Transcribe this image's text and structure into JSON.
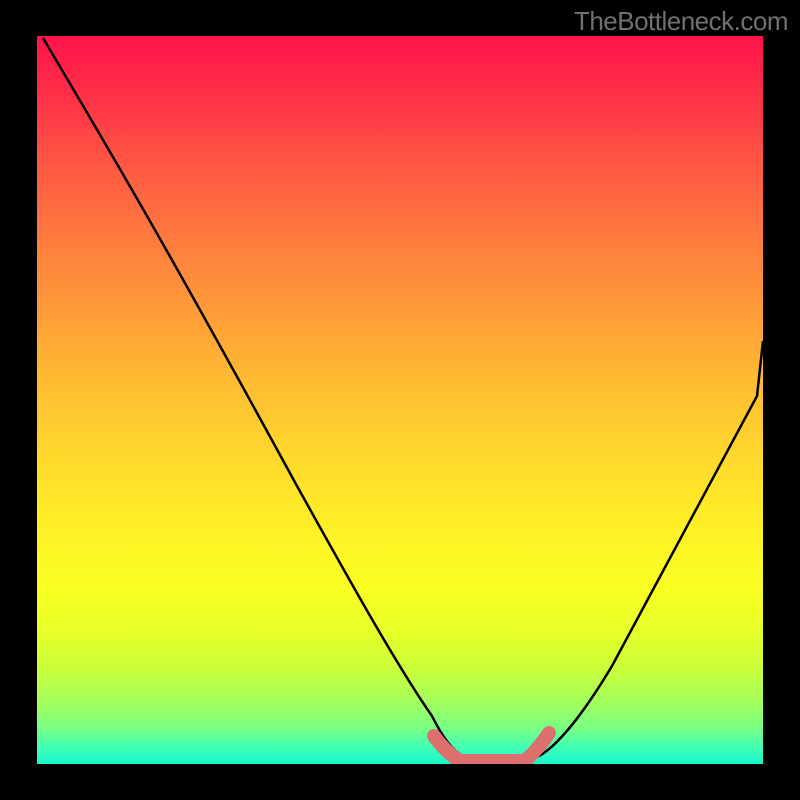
{
  "watermark": "TheBottleneck.com",
  "chart_data": {
    "type": "line",
    "title": "",
    "xlabel": "",
    "ylabel": "",
    "xlim": [
      0,
      100
    ],
    "ylim": [
      0,
      100
    ],
    "series": [
      {
        "name": "curve",
        "x": [
          0,
          5,
          10,
          15,
          20,
          25,
          30,
          35,
          40,
          45,
          50,
          52,
          54,
          56,
          58,
          60,
          62,
          64,
          66,
          68,
          70,
          75,
          80,
          85,
          90,
          95,
          100
        ],
        "y": [
          99,
          93,
          86,
          79,
          71,
          63,
          55,
          46,
          37,
          28,
          18,
          12,
          7,
          3,
          1,
          0,
          0,
          0,
          0,
          1,
          3,
          10,
          20,
          30,
          40,
          49,
          58
        ],
        "stroke": "#000000"
      }
    ],
    "markers": {
      "name": "highlight",
      "color": "#e27070",
      "segments": [
        {
          "x_start": 55,
          "x_end": 58,
          "y": 2
        },
        {
          "x_start": 58,
          "x_end": 67,
          "y": 0
        },
        {
          "x_start": 67,
          "x_end": 70,
          "y": 2
        }
      ]
    },
    "background": "vertical-gradient red→orange→yellow→green"
  }
}
